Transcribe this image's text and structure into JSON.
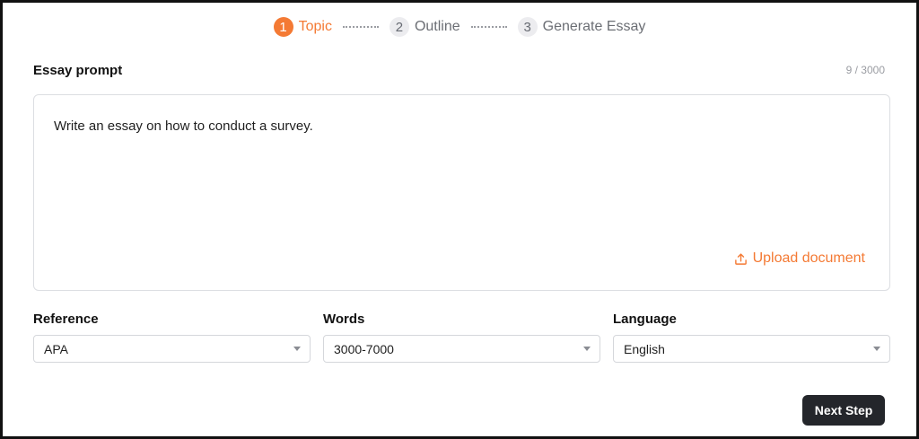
{
  "stepper": {
    "steps": [
      {
        "number": "1",
        "label": "Topic",
        "active": true
      },
      {
        "number": "2",
        "label": "Outline",
        "active": false
      },
      {
        "number": "3",
        "label": "Generate Essay",
        "active": false
      }
    ]
  },
  "prompt": {
    "title": "Essay prompt",
    "char_count": "9 / 3000",
    "value": "Write an essay on how to conduct a survey.",
    "upload_label": "Upload document",
    "upload_icon": "upload-icon"
  },
  "fields": {
    "reference": {
      "label": "Reference",
      "value": "APA"
    },
    "words": {
      "label": "Words",
      "value": "3000-7000"
    },
    "language": {
      "label": "Language",
      "value": "English"
    }
  },
  "actions": {
    "next_label": "Next Step"
  },
  "colors": {
    "accent": "#f47a34",
    "button_bg": "#24262b",
    "inactive_step_bg": "#ececef"
  }
}
